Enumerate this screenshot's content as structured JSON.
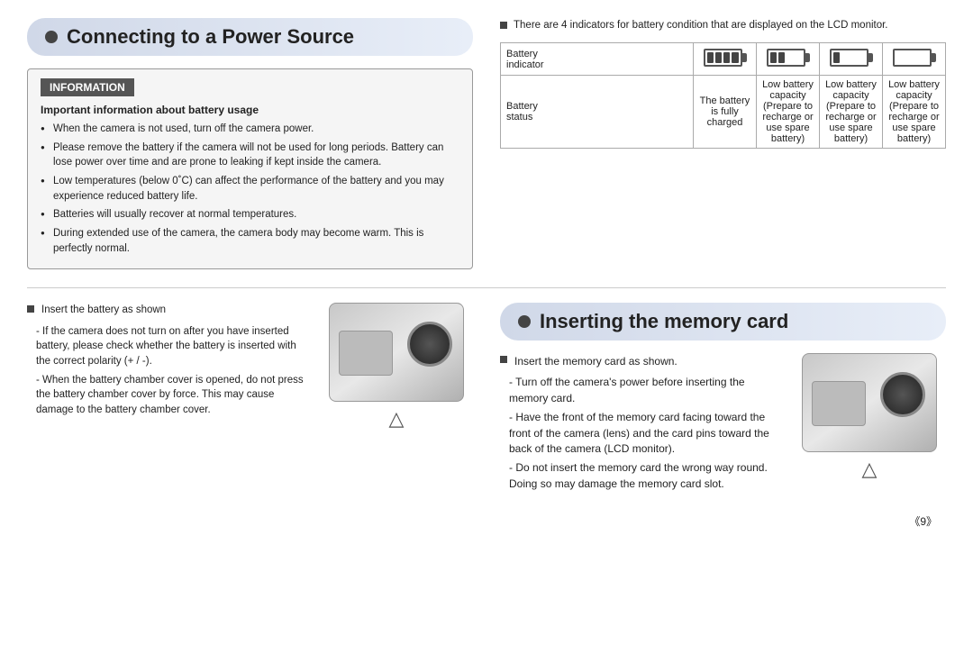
{
  "page": {
    "page_number": "《9》"
  },
  "connecting_section": {
    "title": "Connecting to a Power Source",
    "info_header": "INFORMATION",
    "info_subtitle": "Important information about battery usage",
    "info_items": [
      "When the camera is not used, turn off the camera power.",
      "Please remove the battery if the camera will not be used for long periods. Battery can lose power over time and are prone to leaking if kept inside the camera.",
      "Low temperatures (below 0˚C) can affect the performance of the battery and you may experience reduced battery life.",
      "Batteries will usually recover at normal temperatures.",
      "During extended use of the camera, the camera body may become warm. This is perfectly normal."
    ],
    "battery_intro": "There are 4 indicators for battery condition that are displayed on the LCD monitor.",
    "battery_table": {
      "row1_label": "Battery indicator",
      "row2_label": "Battery status",
      "col1_status": "The battery is fully charged",
      "col2_status": "Low battery capacity (Prepare to recharge or use spare battery)",
      "col3_status": "Low battery capacity (Prepare to recharge or use spare battery)",
      "col4_status": "Low battery capacity (Prepare to recharge or use spare battery)"
    }
  },
  "battery_insert_section": {
    "main_bullet": "Insert the battery as shown",
    "sub_item1": "- If the camera does not turn on after you have inserted battery, please check whether the battery is inserted with the correct polarity (+ / -).",
    "sub_item2": "- When the battery chamber cover is opened, do not press the battery chamber cover by force. This may cause damage to the battery chamber cover."
  },
  "memory_section": {
    "title": "Inserting the memory card",
    "main_bullet": "Insert the memory card as shown.",
    "sub_item1": "- Turn off the camera's power before inserting the memory card.",
    "sub_item2": "- Have the front of the memory card facing toward the front of the camera (lens) and the card pins toward the back of the camera (LCD monitor).",
    "sub_item3": "- Do not insert the memory card the wrong way round. Doing so may damage the memory card slot."
  }
}
